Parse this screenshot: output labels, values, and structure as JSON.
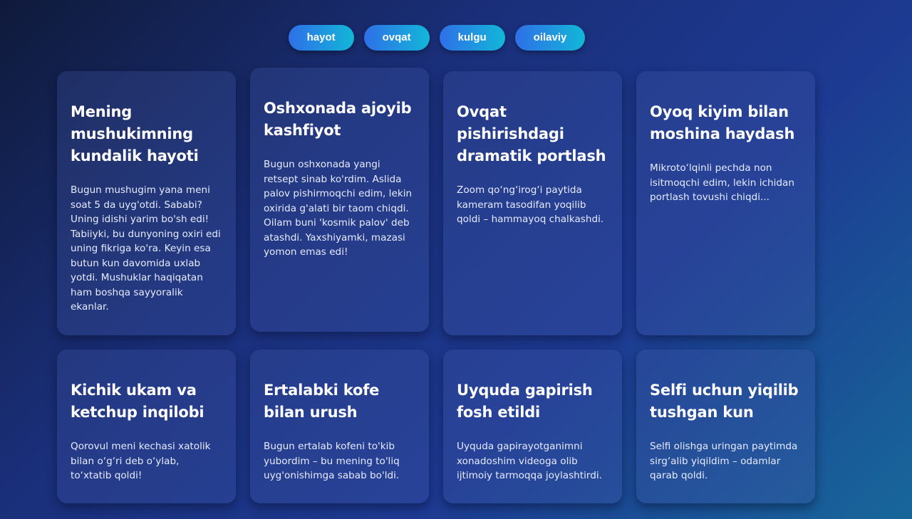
{
  "tags": [
    "hayot",
    "ovqat",
    "kulgu",
    "oilaviy"
  ],
  "cards": [
    {
      "title": "Mening mushukimning kundalik hayoti",
      "text": "Bugun mushugim yana meni soat 5 da uyg'otdi. Sababi? Uning idishi yarim bo'sh edi! Tabiiyki, bu dunyoning oxiri edi uning fikriga ko'ra. Keyin esa butun kun davomida uxlab yotdi. Mushuklar haqiqatan ham boshqa sayyoralik ekanlar."
    },
    {
      "title": "Oshxonada ajoyib kashfiyot",
      "text": "Bugun oshxonada yangi retsept sinab ko'rdim. Aslida palov pishirmoqchi edim, lekin oxirida g'alati bir taom chiqdi. Oilam buni 'kosmik palov' deb atashdi. Yaxshiyamki, mazasi yomon emas edi!"
    },
    {
      "title": "Ovqat pishirishdagi dramatik portlash",
      "text": "Zoom qo‘ng‘irog‘i paytida kameram tasodifan yoqilib qoldi – hammayoq chalkashdi."
    },
    {
      "title": "Oyoq kiyim bilan moshina haydash",
      "text": "Mikroto‘lqinli pechda non isitmoqchi edim, lekin ichidan portlash tovushi chiqdi..."
    },
    {
      "title": "Kichik ukam va ketchup inqilobi",
      "text": "Qorovul meni kechasi xatolik bilan o‘g‘ri deb o‘ylab, to‘xtatib qoldi!"
    },
    {
      "title": "Ertalabki kofe bilan urush",
      "text": "Bugun ertalab kofeni to'kib yubordim – bu mening to'liq uyg'onishimga sabab bo'ldi."
    },
    {
      "title": "Uyquda gapirish fosh etildi",
      "text": "Uyquda gapirayotganimni xonadoshim videoga olib ijtimoiy tarmoqqa joylashtirdi."
    },
    {
      "title": "Selfi uchun yiqilib tushgan kun",
      "text": "Selfi olishga uringan paytimda sirg‘alib yiqildim – odamlar qarab qoldi."
    }
  ]
}
